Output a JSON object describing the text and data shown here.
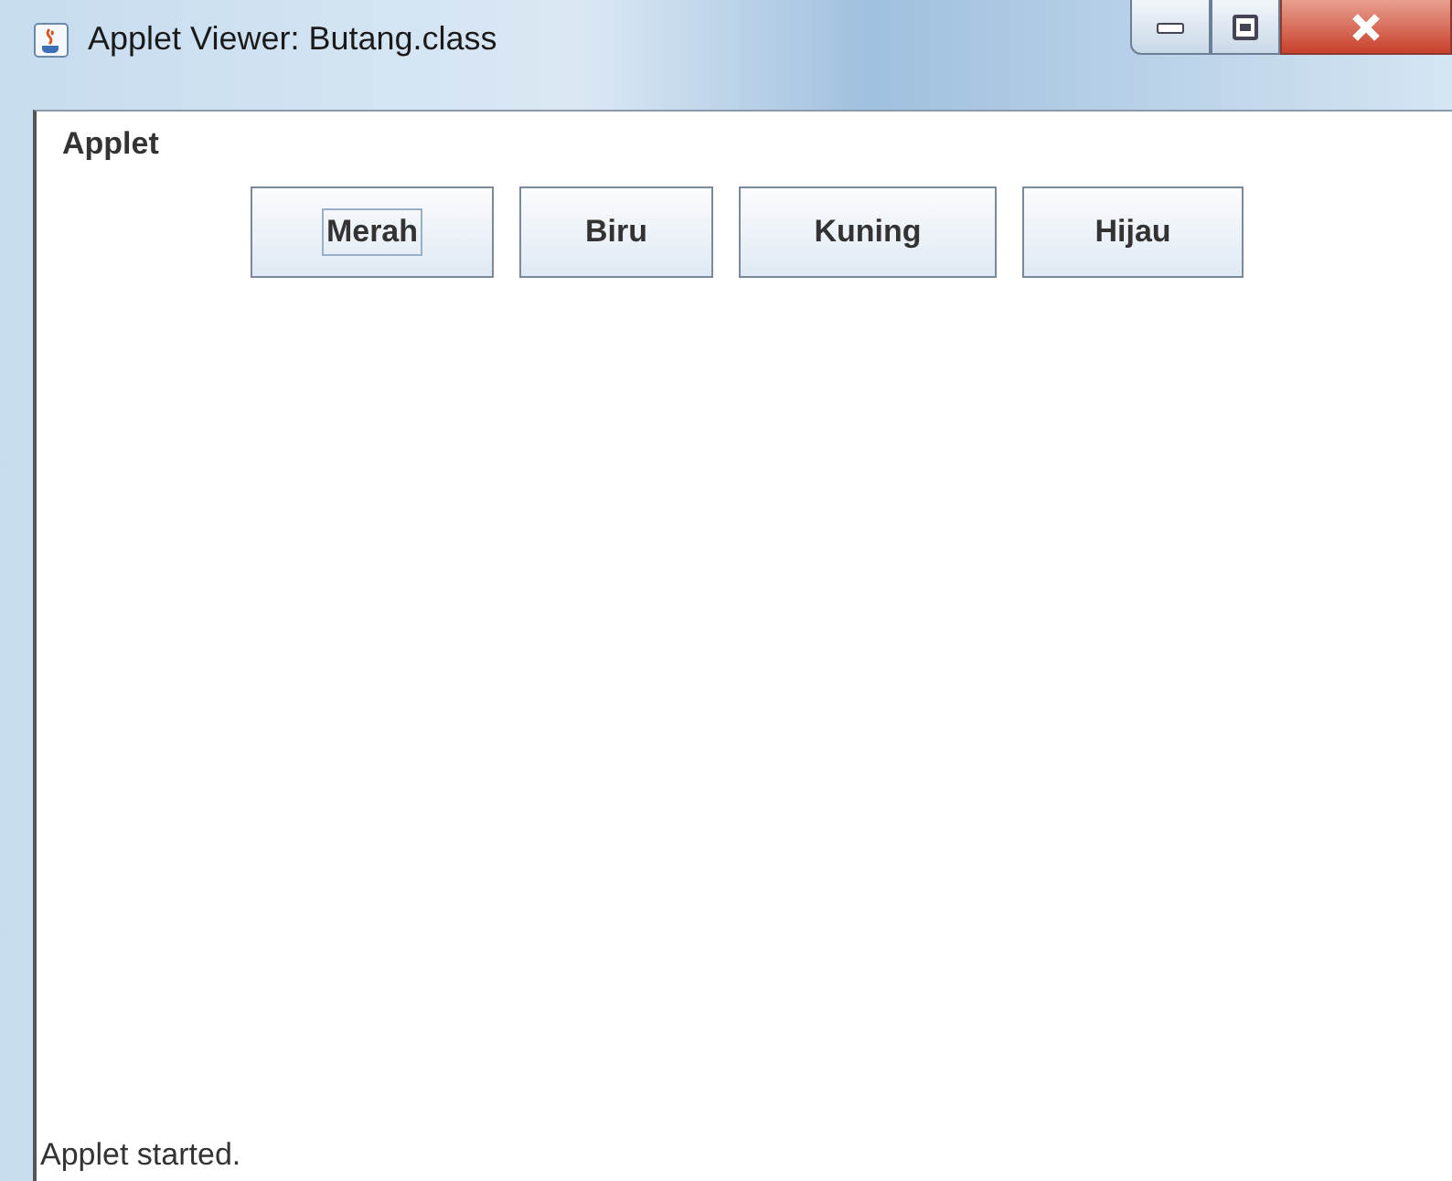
{
  "window": {
    "title": "Applet Viewer: Butang.class"
  },
  "menu": [
    "Applet"
  ],
  "buttons": [
    {
      "label": "Merah",
      "focused": true
    },
    {
      "label": "Biru",
      "focused": false
    },
    {
      "label": "Kuning",
      "focused": false
    },
    {
      "label": "Hijau",
      "focused": false
    }
  ],
  "status_bar": "Applet started."
}
